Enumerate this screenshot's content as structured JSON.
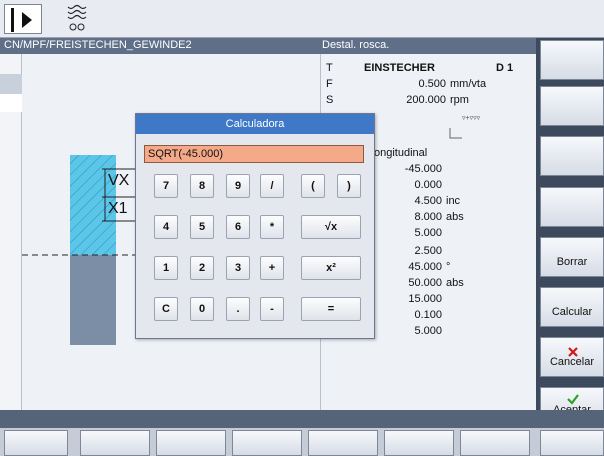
{
  "header": {
    "path": "CN/MPF/FREISTECHEN_GEWINDE2",
    "title": "Destal. rosca."
  },
  "params": {
    "T_label": "T",
    "T_value": "EINSTECHER",
    "D_value": "D 1",
    "F_label": "F",
    "F_value": "0.500",
    "F_unit": "mm/vta",
    "S_label": "S",
    "S_value": "200.000",
    "S_unit": "rpm",
    "mode": "ongitudinal",
    "rows": [
      {
        "value": "-45.000",
        "unit": ""
      },
      {
        "value": "0.000",
        "unit": ""
      },
      {
        "value": "4.500",
        "unit": "inc"
      },
      {
        "value": "8.000",
        "unit": "abs"
      },
      {
        "value": "5.000",
        "unit": ""
      },
      {
        "value": "2.500",
        "unit": ""
      },
      {
        "value": "45.000",
        "unit": "°"
      },
      {
        "value": "50.000",
        "unit": "abs"
      },
      {
        "value": "15.000",
        "unit": ""
      },
      {
        "value": "0.100",
        "unit": ""
      },
      {
        "value": "5.000",
        "unit": ""
      }
    ]
  },
  "graphic": {
    "label_vx": "VX",
    "label_x1": "X1"
  },
  "calculator": {
    "title": "Calculadora",
    "input_value": "SQRT(-45.000)",
    "keys": {
      "k7": "7",
      "k8": "8",
      "k9": "9",
      "kdiv": "/",
      "klp": "(",
      "krp": ")",
      "k4": "4",
      "k5": "5",
      "k6": "6",
      "kmul": "*",
      "ksqrt": "√x",
      "k1": "1",
      "k2": "2",
      "k3": "3",
      "kplus": "+",
      "ksq": "x²",
      "kc": "C",
      "k0": "0",
      "kdot": ".",
      "kminus": "-",
      "keq": "="
    }
  },
  "softkeys": {
    "borrar": "Borrar",
    "calcular": "Calcular",
    "cancelar": "Cancelar",
    "aceptar": "Aceptar"
  },
  "colors": {
    "title_bar": "#3e78c6",
    "input_bg": "#f4a989",
    "cancel_icon": "#d01818",
    "accept_icon": "#2aa02a",
    "graphic_fill": "#5bc6e8"
  }
}
